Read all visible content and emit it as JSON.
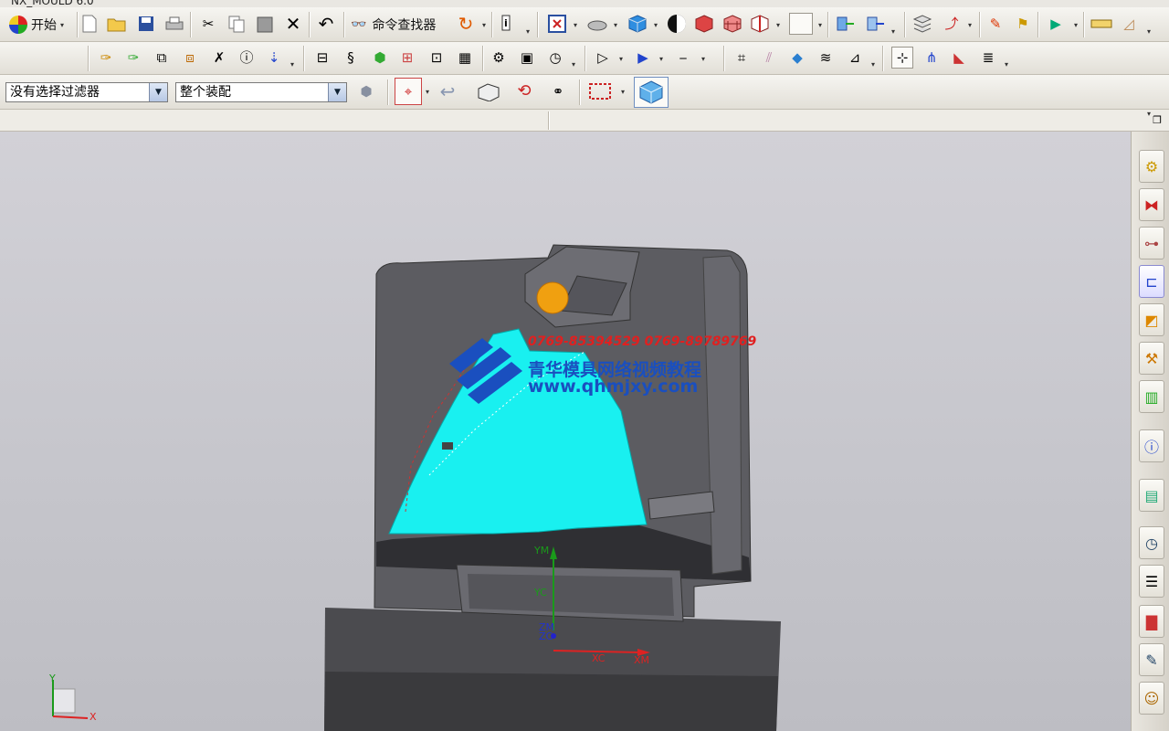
{
  "window": {
    "title": "NX_MOULD 6.0"
  },
  "toolbar1": {
    "start_label": "开始",
    "command_finder_label": "命令查找器"
  },
  "toolbar3": {
    "selection_filter": "没有选择过滤器",
    "assembly_scope": "整个装配"
  },
  "watermark": {
    "phones": "0769-85394529  0769-89789769",
    "title": "青华模具网络视频教程",
    "url": "www.qhmjxy.com"
  },
  "csys": {
    "ym": "YM",
    "yc": "YC",
    "zm": "ZM",
    "zc": "ZC",
    "xc": "XC",
    "xm": "XM"
  },
  "triad": {
    "y": "Y",
    "x": "X"
  },
  "icons": {
    "row1": [
      "new-file-icon",
      "open-folder-icon",
      "save-icon",
      "print-icon",
      "cut-icon",
      "copy-icon",
      "paste-icon",
      "delete-icon",
      "undo-icon",
      "repeat-icon",
      "info-icon",
      "fit-icon",
      "orient-icon",
      "shaded-icon",
      "render-style-icon",
      "section-icon",
      "face-icon",
      "background-icon",
      "layer-icon",
      "move-icon",
      "analysis-icon",
      "measure-icon",
      "snap-icon",
      "pattern-icon",
      "ruler-icon",
      "draft-icon"
    ],
    "row2": [
      "sketch-icon",
      "extrude-icon",
      "revolve-icon",
      "trim-icon",
      "offset-icon",
      "sew-icon",
      "table-icon",
      "library-icon",
      "settings-icon",
      "rebuild-icon",
      "clock-icon",
      "select-icon",
      "arrow-icon",
      "line-icon",
      "csys-icon",
      "attach-icon",
      "cube-icon",
      "grid-icon",
      "feature-icon",
      "highlight-icon",
      "dim-icon",
      "fillet-icon",
      "chamfer-icon",
      "draft-angle-icon"
    ],
    "right": [
      "assembly-nav-icon",
      "constraint-icon",
      "part-nav-icon",
      "reuse-icon",
      "history-icon",
      "library-icon",
      "color-icon",
      "info-icon",
      "web-icon",
      "clock-icon",
      "doc-icon",
      "palette-icon",
      "pen-icon",
      "role-icon"
    ]
  }
}
